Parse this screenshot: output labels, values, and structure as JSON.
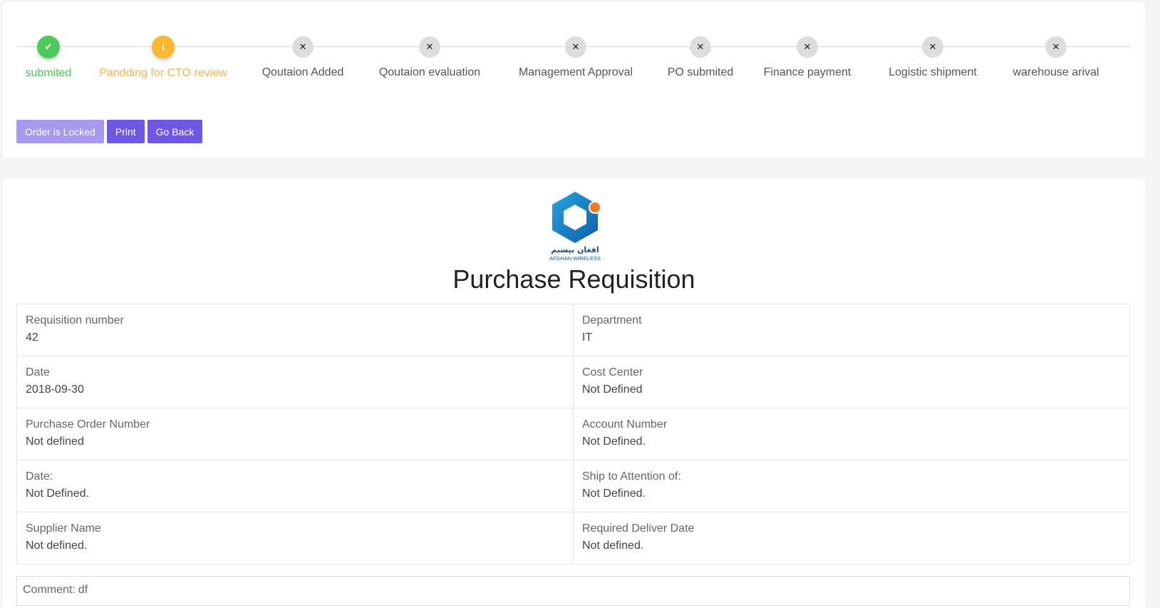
{
  "progress": {
    "steps": [
      {
        "label": "submited",
        "state": "done",
        "icon": "check-icon"
      },
      {
        "label": "Pandding for CTO review",
        "state": "pending",
        "icon": "info-icon"
      },
      {
        "label": "Qoutaion Added",
        "state": "todo",
        "icon": "x-icon"
      },
      {
        "label": "Qoutaion evaluation",
        "state": "todo",
        "icon": "x-icon"
      },
      {
        "label": "Management Approval",
        "state": "todo",
        "icon": "x-icon"
      },
      {
        "label": "PO submited",
        "state": "todo",
        "icon": "x-icon"
      },
      {
        "label": "Finance payment",
        "state": "todo",
        "icon": "x-icon"
      },
      {
        "label": "Logistic shipment",
        "state": "todo",
        "icon": "x-icon"
      },
      {
        "label": "warehouse arival",
        "state": "todo",
        "icon": "x-icon"
      }
    ],
    "glyphs": {
      "done": "✔",
      "pending": "i",
      "todo": "✕"
    }
  },
  "actions": {
    "locked_label": "Order is Locked",
    "print_label": "Print",
    "back_label": "Go Back"
  },
  "colors": {
    "accent": "#7056e4",
    "locked": "#a699ef",
    "done": "#4ccb5c",
    "pending": "#fbb730",
    "logo_blue": "#1a7fc8",
    "logo_orange": "#f47a20"
  },
  "document": {
    "logo": {
      "text_ar": "افغان بیسیم",
      "text_en": "AFGHAN WIRELESS"
    },
    "title": "Purchase Requisition",
    "fields": [
      [
        {
          "label": "Requisition number",
          "value": "42"
        },
        {
          "label": "Department",
          "value": "IT"
        }
      ],
      [
        {
          "label": "Date",
          "value": "2018-09-30"
        },
        {
          "label": "Cost Center",
          "value": "Not Defined"
        }
      ],
      [
        {
          "label": "Purchase Order Number",
          "value": "Not defined"
        },
        {
          "label": "Account Number",
          "value": "Not Defined."
        }
      ],
      [
        {
          "label": "Date:",
          "value": "Not Defined."
        },
        {
          "label": "Ship to Attention of:",
          "value": "Not Defined."
        }
      ],
      [
        {
          "label": "Supplier Name",
          "value": "Not defined."
        },
        {
          "label": "Required Deliver Date",
          "value": "Not defined."
        }
      ]
    ],
    "comment_label": "Comment:",
    "comment_value": "df"
  }
}
